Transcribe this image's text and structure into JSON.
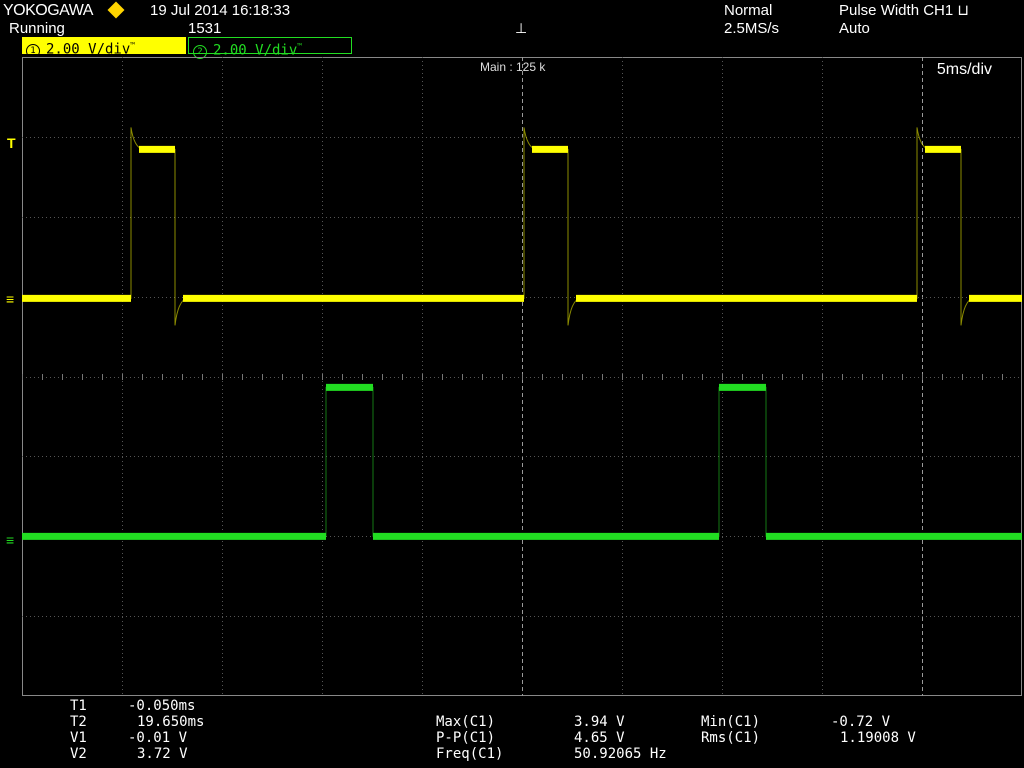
{
  "header": {
    "brand": "YOKOGAWA",
    "datetime": "19 Jul 2014  16:18:33",
    "status": "Running",
    "acquisition_count": "1531",
    "acq_mode": "Normal",
    "sample_rate": "2.5MS/s",
    "trigger_type": "Pulse Width CH1 ⊔",
    "trigger_mode": "Auto",
    "trigger_icon": "⊥"
  },
  "channels": {
    "ch1": {
      "number": "1",
      "scale": "2.00 V/div",
      "suffix": "™",
      "color": "#ffff00"
    },
    "ch2": {
      "number": "2",
      "scale": "2.00 V/div",
      "suffix": "™",
      "color": "#22dd22"
    }
  },
  "display": {
    "main_label": "Main : 125 k",
    "timebase": "5ms/div",
    "trigger_level_marker": "T",
    "ground_marker": "≡"
  },
  "cursors": {
    "t1_label": "T1",
    "t1_value": "-0.050ms",
    "t2_label": "T2",
    "t2_value": "19.650ms",
    "v1_label": "V1",
    "v1_value": "-0.01 V",
    "v2_label": "V2",
    "v2_value": "3.72 V"
  },
  "measurements": {
    "max_label": "Max(C1)",
    "max_value": "3.94 V",
    "pp_label": "P-P(C1)",
    "pp_value": "4.65 V",
    "freq_label": "Freq(C1)",
    "freq_value": "50.92065 Hz",
    "min_label": "Min(C1)",
    "min_value": "-0.72 V",
    "rms_label": "Rms(C1)",
    "rms_value": "1.19008 V"
  },
  "chart_data": {
    "type": "line",
    "timebase_ms_per_div": 5,
    "volts_per_div": 2.0,
    "divisions_x": 10,
    "divisions_y": 8,
    "grid": true,
    "period_ms": 19.64,
    "series": [
      {
        "name": "CH1",
        "high_v": 3.72,
        "low_v": -0.01,
        "pulse_start_ms": [
          5.45,
          25.1,
          44.75
        ],
        "pulse_width_ms": 2.2
      },
      {
        "name": "CH2",
        "high_v": 3.72,
        "low_v": -0.01,
        "pulse_start_ms": [
          15.2,
          34.85
        ],
        "pulse_width_ms": 2.35
      }
    ]
  }
}
